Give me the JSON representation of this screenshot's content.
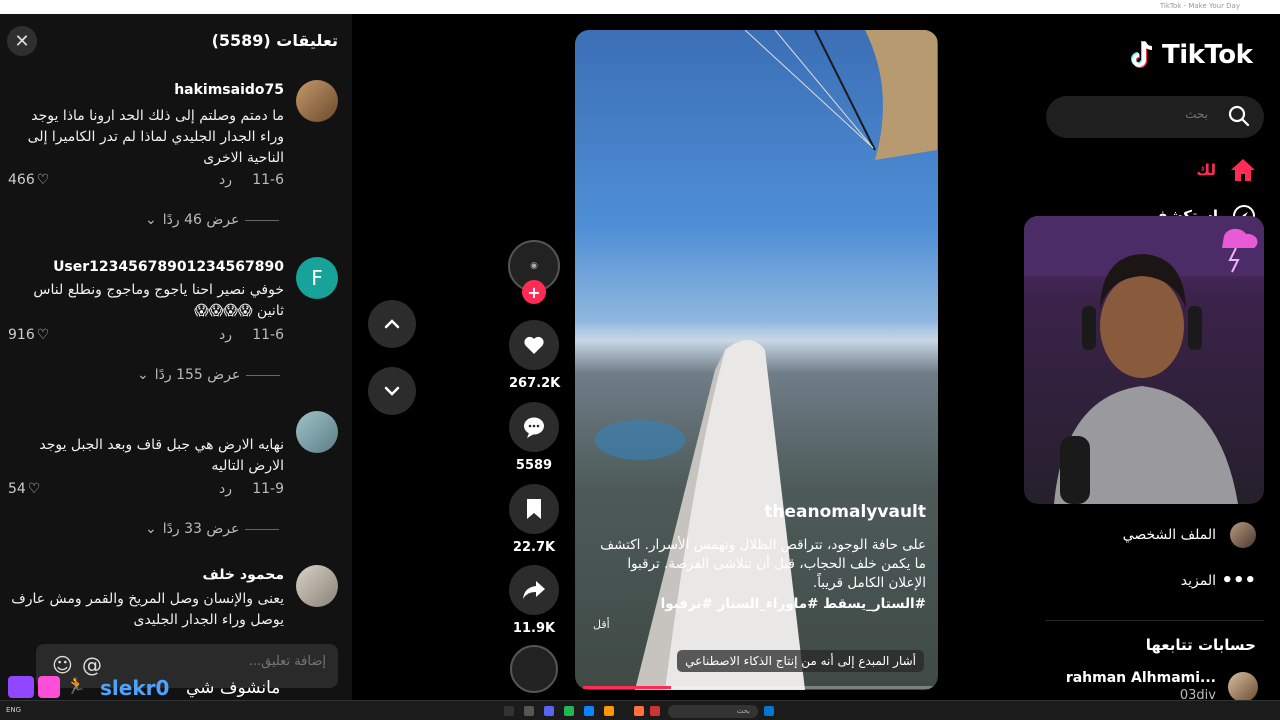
{
  "window": {
    "title": "TikTok - Make Your Day"
  },
  "comments_panel": {
    "title": "تعليقات (5589)",
    "input_placeholder": "إضافة تعليق...",
    "comments": [
      {
        "user": "hakimsaido75",
        "text": "ما دمتم وصلتم إلى ذلك الحد ارونا ماذا يوجد وراء الجدار الجليدي لماذا لم تدر الكاميرا إلى الناحية الاخرى",
        "date": "11-6",
        "reply": "رد",
        "likes": "466",
        "views": "عرض 46 ردًا"
      },
      {
        "user": "User12345678901234567890",
        "text": "خوفي نصير احنا ياجوج وماجوج ونطلع لناس ثانين 😱😱😱😱",
        "date": "11-6",
        "reply": "رد",
        "likes": "916",
        "views": "عرض 155 ردًا",
        "avatar_letter": "F"
      },
      {
        "user": "",
        "text": "نهايه الارض هي جبل قاف وبعد الجبل يوجد الارض التاليه",
        "date": "11-9",
        "reply": "رد",
        "likes": "54",
        "views": "عرض 33 ردًا"
      },
      {
        "user": "محمود خلف",
        "text": "يعنى والإنسان وصل المريخ والقمر ومش عارف يوصل وراء الجدار الجليدى"
      }
    ]
  },
  "overlay": {
    "streamer": "slekr0",
    "message": "مانشوف شي"
  },
  "video": {
    "author": "theanomalyvault",
    "description": "على حافة الوجود، تتراقص الظلال وتهمس الأسرار. اكتشف ما يكمن خلف الحجاب، قبل أن تتلاشى الفرصة. ترقبوا الإعلان الكامل قريباً.",
    "hashtags": "#الستار_يسقط #ماوراء_الستار #ترقبوا",
    "less_label": "أقل",
    "ai_label": "أشار المبدع إلى أنه من إنتاج الذكاء الاصطناعي",
    "progress": 0.25
  },
  "actions": {
    "likes": "267.2K",
    "comments": "5589",
    "saves": "22.7K",
    "shares": "11.9K"
  },
  "sidebar": {
    "brand": "TikTok",
    "search_placeholder": "بحث",
    "nav": [
      {
        "label": "لك"
      },
      {
        "label": "استكشف"
      },
      {
        "label": "الملف الشخصي"
      },
      {
        "label": "المزيد"
      }
    ],
    "following_title": "حسابات تتابعها",
    "following": [
      {
        "name": "rahman Alhmami...",
        "handle": "03div"
      }
    ]
  },
  "taskbar": {
    "search": "بحث",
    "tray_lang": "ENG"
  },
  "colors": {
    "accent": "#fe2c55",
    "panel": "#121212",
    "streamer_name": "#4ea3ff"
  }
}
